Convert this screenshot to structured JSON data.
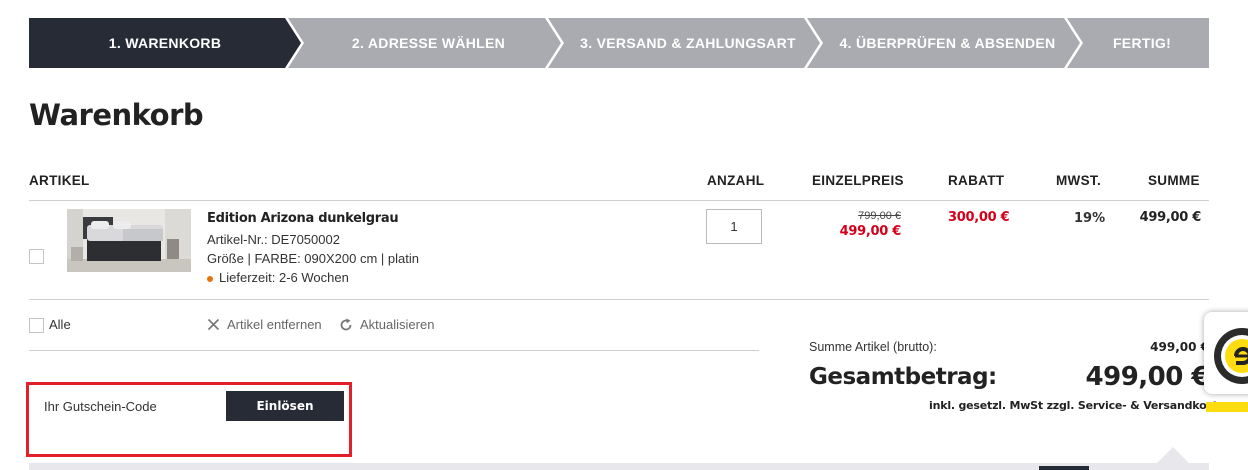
{
  "steps": [
    {
      "label": "1. WARENKORB",
      "active": true
    },
    {
      "label": "2. ADRESSE WÄHLEN",
      "active": false
    },
    {
      "label": "3. VERSAND & ZAHLUNGSART",
      "active": false
    },
    {
      "label": "4. ÜBERPRÜFEN & ABSENDEN",
      "active": false
    },
    {
      "label": "FERTIG!",
      "active": false
    }
  ],
  "colors": {
    "active_step": "#262b36",
    "inactive_step": "#a9abb0",
    "sale_red": "#d4001a",
    "highlight_red": "#e3202a",
    "button_dark": "#262b36",
    "lieferzeit_dot": "#e8730d"
  },
  "page_title": "Warenkorb",
  "table": {
    "headers": {
      "artikel": "ARTIKEL",
      "anzahl": "ANZAHL",
      "einzelpreis": "EINZELPREIS",
      "rabatt": "RABATT",
      "mwst": "MWST.",
      "summe": "SUMME"
    },
    "item": {
      "name": "Edition Arizona dunkelgrau",
      "article_no": "Artikel-Nr.: DE7050002",
      "variant": "Größe | FARBE: 090X200 cm | platin",
      "delivery": "Lieferzeit: 2-6 Wochen",
      "quantity": "1",
      "old_price": "799,00 €",
      "price": "499,00 €",
      "discount": "300,00 €",
      "vat": "19%",
      "total": "499,00 €"
    }
  },
  "actions": {
    "select_all": "Alle",
    "remove": "Artikel entfernen",
    "update": "Aktualisieren"
  },
  "voucher": {
    "placeholder": "Ihr Gutschein-Code",
    "button": "Einlösen"
  },
  "summary": {
    "subtotal_label": "Summe Artikel (brutto):",
    "subtotal_value": "499,00 €",
    "total_label": "Gesamtbetrag:",
    "total_value": "499,00 €",
    "tax_note": "inkl. gesetzl. MwSt zzgl. Service- & Versandkosten"
  },
  "icons": {
    "remove": "close-icon",
    "update": "refresh-icon",
    "trust": "trusted-shops-seal-icon"
  }
}
